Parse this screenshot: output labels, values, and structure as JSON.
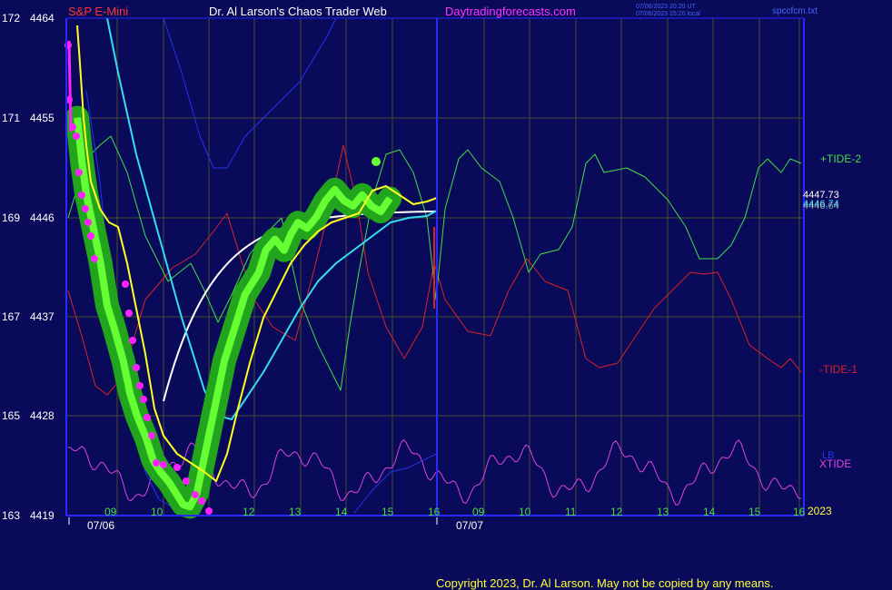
{
  "header": {
    "instrument": "S&P E-Mini",
    "title": "Dr. Al Larson's Chaos Trader Web",
    "site": "Daytradingforecasts.com",
    "timestamp_utc": "07/06/2023 20:20 UT",
    "timestamp_local": "07/06/2023 15:20 local",
    "filename": "spccfcm.txt"
  },
  "footer": {
    "copyright": "Copyright 2023, Dr. Al Larson. May not be copied by any means."
  },
  "colors": {
    "background": "#0a0a5a",
    "grid": "#4a4a32",
    "axis": "#2828ff",
    "price_green": "#22a51c",
    "price_bright": "#66ff33",
    "yellow_avg": "#ffff22",
    "cyan_avg": "#33ddee",
    "white_avg": "#ffffff",
    "blue_line": "#2233ee",
    "tide2": "#44dd44",
    "tide1": "#dd2222",
    "xtide": "#dd44dd",
    "magenta_marks": "#ff22ff"
  },
  "chart_data": {
    "type": "line",
    "y_left_outer_labels": [
      "172",
      "171",
      "169",
      "167",
      "165",
      "163"
    ],
    "y_left_inner_labels": [
      "4464",
      "4455",
      "4446",
      "4437",
      "4428",
      "4419"
    ],
    "ylim": [
      4419,
      4464
    ],
    "hour_ticks": [
      "09",
      "10",
      "11",
      "12",
      "13",
      "14",
      "15",
      "16",
      "09",
      "10",
      "11",
      "12",
      "13",
      "14",
      "15",
      "16"
    ],
    "date_labels": [
      "07/06",
      "07/07"
    ],
    "year_label": "2023",
    "right_values": [
      "4447.73",
      "4446.74",
      "4446.64"
    ],
    "legend": [
      "+TIDE-2",
      "-TIDE-1",
      "LB",
      "XTIDE"
    ],
    "price_path": [
      [
        8.2,
        4455
      ],
      [
        8.3,
        4451
      ],
      [
        8.4,
        4448
      ],
      [
        8.5,
        4446
      ],
      [
        8.7,
        4442
      ],
      [
        8.85,
        4438
      ],
      [
        9.0,
        4436
      ],
      [
        9.2,
        4433
      ],
      [
        9.35,
        4430
      ],
      [
        9.5,
        4428
      ],
      [
        9.7,
        4426
      ],
      [
        9.85,
        4424
      ],
      [
        10.0,
        4423
      ],
      [
        10.2,
        4422
      ],
      [
        10.35,
        4421
      ],
      [
        10.5,
        4420
      ],
      [
        10.65,
        4419.8
      ],
      [
        10.8,
        4421
      ],
      [
        10.95,
        4424
      ],
      [
        11.1,
        4427
      ],
      [
        11.25,
        4430
      ],
      [
        11.4,
        4433
      ],
      [
        11.55,
        4435
      ],
      [
        11.7,
        4437
      ],
      [
        11.85,
        4439
      ],
      [
        12.0,
        4440
      ],
      [
        12.15,
        4441
      ],
      [
        12.3,
        4443
      ],
      [
        12.5,
        4444
      ],
      [
        12.7,
        4443
      ],
      [
        12.85,
        4444.5
      ],
      [
        13.0,
        4445.5
      ],
      [
        13.2,
        4445
      ],
      [
        13.4,
        4446
      ],
      [
        13.6,
        4447.5
      ],
      [
        13.8,
        4448.5
      ],
      [
        14.0,
        4447.5
      ],
      [
        14.2,
        4447
      ],
      [
        14.4,
        4448
      ],
      [
        14.6,
        4447
      ],
      [
        14.8,
        4446.5
      ],
      [
        15.0,
        4447.7
      ]
    ]
  }
}
